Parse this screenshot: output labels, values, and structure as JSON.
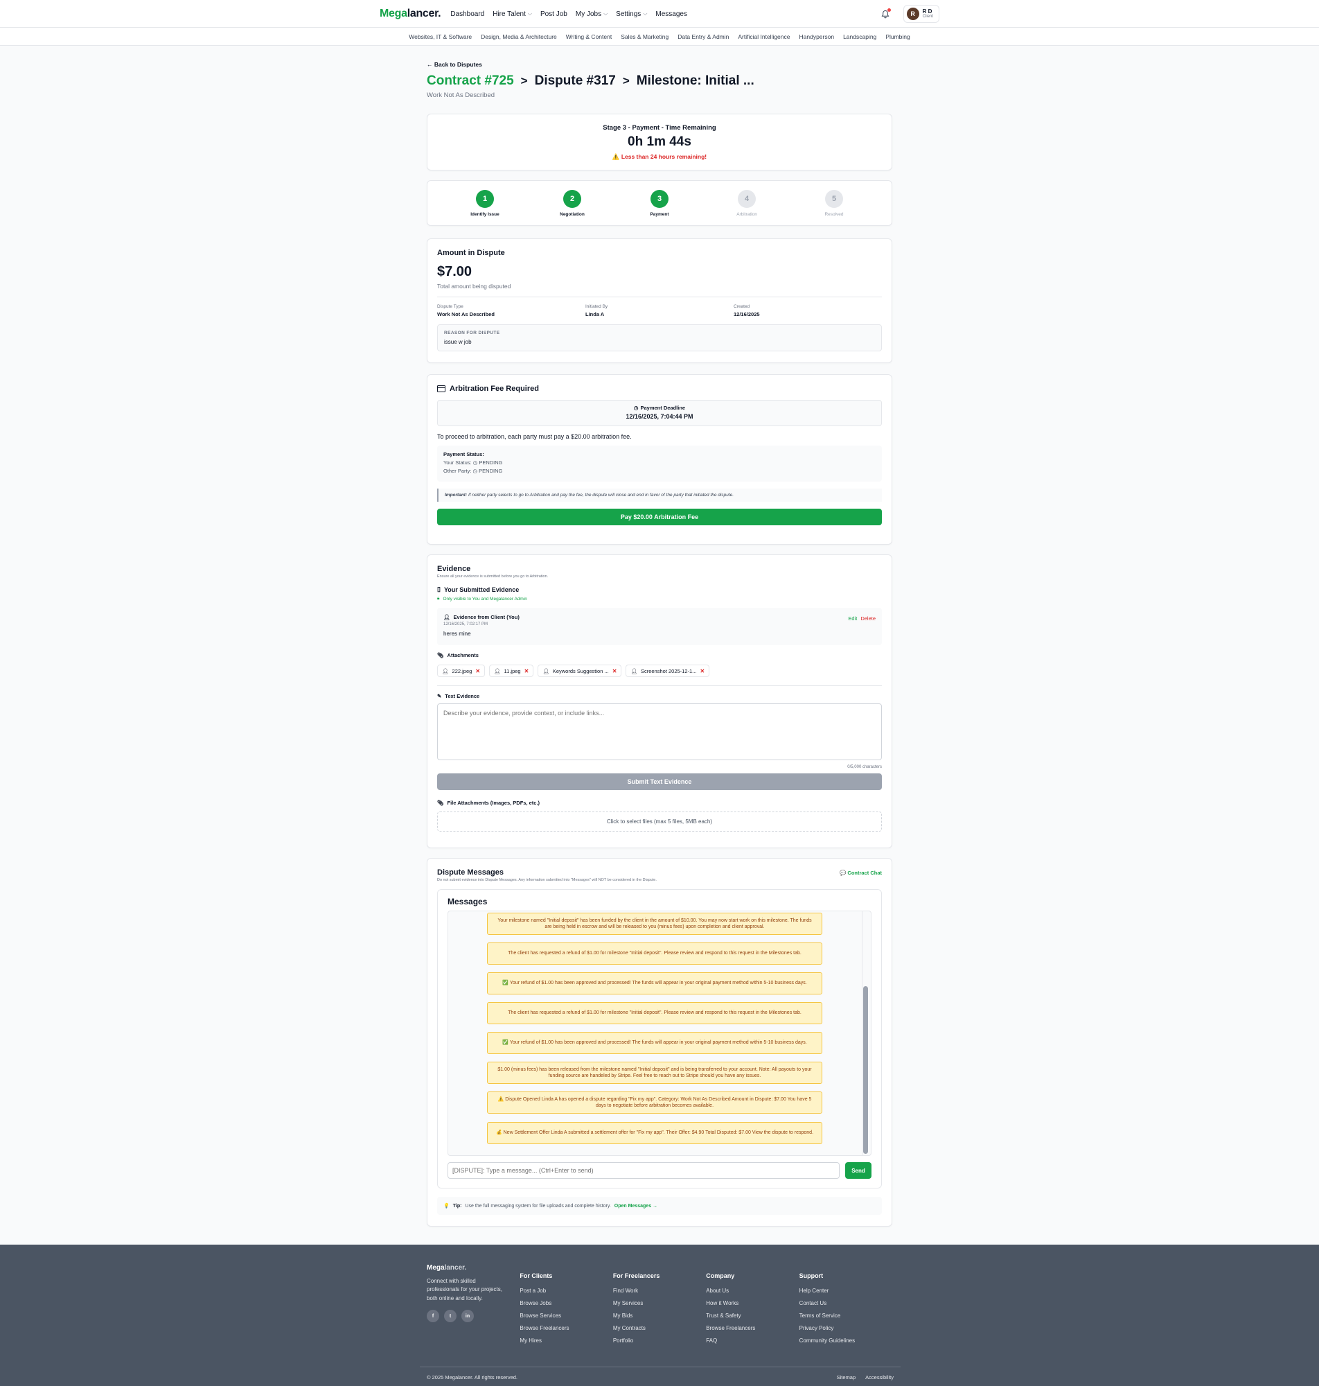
{
  "nav": {
    "logo_green": "Mega",
    "logo_dark": "lancer.",
    "items": [
      "Dashboard",
      "Hire Talent",
      "Post Job",
      "My Jobs",
      "Settings",
      "Messages"
    ],
    "user_initial": "R",
    "user_name": "R D",
    "user_role": "Client"
  },
  "categories": [
    "Websites, IT & Software",
    "Design, Media & Architecture",
    "Writing & Content",
    "Sales & Marketing",
    "Data Entry & Admin",
    "Artificial Intelligence",
    "Handyperson",
    "Landscaping",
    "Plumbing"
  ],
  "header": {
    "back": "← Back to Disputes",
    "contract": "Contract #725",
    "sep": ">",
    "dispute": "Dispute #317",
    "milestone": "Milestone: Initial ...",
    "subtitle": "Work Not As Described"
  },
  "timer": {
    "label": "Stage 3 - Payment - Time Remaining",
    "value": "0h 1m 44s",
    "warning": "⚠️ Less than 24 hours remaining!"
  },
  "steps": [
    {
      "num": "1",
      "label": "Identify Issue"
    },
    {
      "num": "2",
      "label": "Negotiation"
    },
    {
      "num": "3",
      "label": "Payment"
    },
    {
      "num": "4",
      "label": "Arbitration"
    },
    {
      "num": "5",
      "label": "Resolved"
    }
  ],
  "amount": {
    "title": "Amount in Dispute",
    "value": "$7.00",
    "caption": "Total amount being disputed",
    "type_label": "Dispute Type",
    "type_value": "Work Not As Described",
    "initiated_label": "Initiated By",
    "initiated_value": "Linda A",
    "created_label": "Created",
    "created_value": "12/16/2025",
    "reason_label": "REASON FOR DISPUTE",
    "reason_value": "issue w job"
  },
  "fee": {
    "title": "Arbitration Fee Required",
    "deadline_label": "Payment Deadline",
    "deadline_value": "12/16/2025, 7:04:44 PM",
    "desc": "To proceed to arbitration, each party must pay a $20.00 arbitration fee.",
    "status_title": "Payment Status:",
    "your_status_label": "Your Status:",
    "your_status": "PENDING",
    "other_status_label": "Other Party:",
    "other_status": "PENDING",
    "important_label": "Important:",
    "important_text": " If neither party selects to go to Arbitration and pay the fee, the dispute will close and end in favor of the party that initiated the dispute.",
    "pay_button": "Pay $20.00 Arbitration Fee"
  },
  "evidence": {
    "title": "Evidence",
    "note": "Ensure all your evidence is submitted before you go to Arbitration.",
    "submitted_title": "Your Submitted Evidence",
    "visibility": "Only visible to You and Megalancer Admin",
    "item_from": "Evidence from Client (You)",
    "item_date": "12/16/2025, 7:02:17 PM",
    "item_text": "heres mine",
    "edit": "Edit",
    "delete": "Delete",
    "attachments_title": "Attachments",
    "attachments": [
      "222.jpeg",
      "11.jpeg",
      "Keywords Suggestion ...",
      "Screenshot 2025-12-1..."
    ],
    "text_title": "Text Evidence",
    "placeholder": "Describe your evidence, provide context, or include links...",
    "chars": "0/5,000 characters",
    "submit": "Submit Text Evidence",
    "files_title": "File Attachments (Images, PDFs, etc.)",
    "files_drop": "Click to select files (max 5 files, 5MB each)"
  },
  "messages": {
    "title": "Dispute Messages",
    "note": "Do not submit evidence into Dispute Messages. Any information submitted into \"Messages\" will NOT be considered in the Dispute.",
    "contract_chat": "💬 Contract Chat",
    "inner_title": "Messages",
    "list": [
      "Your milestone named \"Initial deposit\" has been funded by the client in the amount of $10.00. You may now start work on this milestone. The funds are being held in escrow and will be released to you (minus fees) upon completion and client approval.",
      "The client has requested a refund of $1.00 for milestone \"Initial deposit\". Please review and respond to this request in the Milestones tab.",
      "✅ Your refund of $1.00 has been approved and processed! The funds will appear in your original payment method within 5-10 business days.",
      "The client has requested a refund of $1.00 for milestone \"Initial deposit\". Please review and respond to this request in the Milestones tab.",
      "✅ Your refund of $1.00 has been approved and processed! The funds will appear in your original payment method within 5-10 business days.",
      "$1.00 (minus fees) has been released from the milestone named \"Initial deposit\" and is being transferred to your account. Note: All payouts to your funding source are handeled by Stripe. Feel free to reach out to Stripe should you have any issues.",
      "⚠️ Dispute Opened Linda A has opened a dispute regarding \"Fix my app\". Category: Work Not As Described Amount in Dispute: $7.00 You have 5 days to negotiate before arbitration becomes available.",
      "💰 New Settlement Offer Linda A submitted a settlement offer for \"Fix my app\". Their Offer: $4.90 Total Disputed: $7.00 View the dispute to respond."
    ],
    "input_placeholder": "[DISPUTE]: Type a message... (Ctrl+Enter to send)",
    "send": "Send",
    "tip_label": "Tip:",
    "tip_text": " Use the full messaging system for file uploads and complete history. ",
    "tip_link": "Open Messages →"
  },
  "footer": {
    "logo_main": "Mega",
    "logo_rest": "lancer.",
    "desc": "Connect with skilled professionals for your projects, both online and locally.",
    "social": [
      "f",
      "t",
      "in"
    ],
    "columns": [
      {
        "title": "For Clients",
        "links": [
          "Post a Job",
          "Browse Jobs",
          "Browse Services",
          "Browse Freelancers",
          "My Hires"
        ]
      },
      {
        "title": "For Freelancers",
        "links": [
          "Find Work",
          "My Services",
          "My Bids",
          "My Contracts",
          "Portfolio"
        ]
      },
      {
        "title": "Company",
        "links": [
          "About Us",
          "How it Works",
          "Trust & Safety",
          "Browse Freelancers",
          "FAQ"
        ]
      },
      {
        "title": "Support",
        "links": [
          "Help Center",
          "Contact Us",
          "Terms of Service",
          "Privacy Policy",
          "Community Guidelines"
        ]
      }
    ],
    "copyright": "© 2025 Megalancer. All rights reserved.",
    "bottom_links": [
      "Sitemap",
      "Accessibility"
    ]
  },
  "colors": {
    "accent": "#16a34a",
    "danger": "#dc2626",
    "footer_bg": "#4b5563",
    "message_bg": "#fef3c7"
  }
}
